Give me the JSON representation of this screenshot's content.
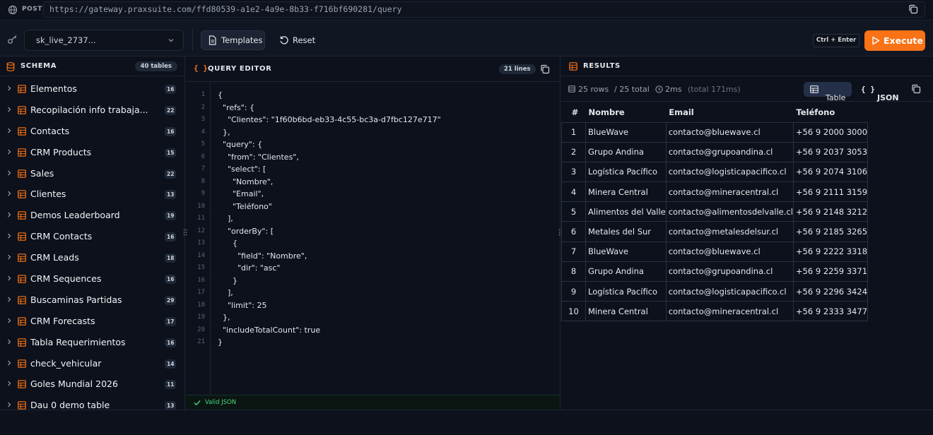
{
  "request": {
    "method": "POST",
    "url": "https://gateway.praxsuite.com/ffd80539-a1e2-4a9e-8b33-f716bf690281/query"
  },
  "toolbar": {
    "api_key": "sk_live_2737...",
    "templates_label": "Templates",
    "reset_label": "Reset",
    "shortcut": "Ctrl + Enter",
    "execute_label": "Execute",
    "accent_color": "#f97316"
  },
  "schema": {
    "title": "SCHEMA",
    "table_count": "40 tables",
    "tables": [
      {
        "name": "Elementos",
        "count": "16"
      },
      {
        "name": "Recopilación info trabaja...",
        "count": "22"
      },
      {
        "name": "Contacts",
        "count": "16"
      },
      {
        "name": "CRM Products",
        "count": "15"
      },
      {
        "name": "Sales",
        "count": "22"
      },
      {
        "name": "Clientes",
        "count": "13"
      },
      {
        "name": "Demos Leaderboard",
        "count": "19"
      },
      {
        "name": "CRM Contacts",
        "count": "16"
      },
      {
        "name": "CRM Leads",
        "count": "18"
      },
      {
        "name": "CRM Sequences",
        "count": "16"
      },
      {
        "name": "Buscaminas Partidas",
        "count": "29"
      },
      {
        "name": "CRM Forecasts",
        "count": "17"
      },
      {
        "name": "Tabla Requerimientos",
        "count": "16"
      },
      {
        "name": "check_vehicular",
        "count": "14"
      },
      {
        "name": "Goles Mundial 2026",
        "count": "11"
      },
      {
        "name": "Dau 0 demo table",
        "count": "13"
      }
    ]
  },
  "editor": {
    "title": "QUERY EDITOR",
    "lines_badge": "21 lines",
    "status": "Valid JSON",
    "lines": [
      "{",
      "  \"refs\": {",
      "    \"Clientes\": \"1f60b6bd-eb33-4c55-bc3a-d7fbc127e717\"",
      "  },",
      "  \"query\": {",
      "    \"from\": \"Clientes\",",
      "    \"select\": [",
      "      \"Nombre\",",
      "      \"Email\",",
      "      \"Teléfono\"",
      "    ],",
      "    \"orderBy\": [",
      "      {",
      "        \"field\": \"Nombre\",",
      "        \"dir\": \"asc\"",
      "      }",
      "    ],",
      "    \"limit\": 25",
      "  },",
      "  \"includeTotalCount\": true",
      "}"
    ]
  },
  "results": {
    "title": "RESULTS",
    "rows_label": "25 rows",
    "total_label": "/ 25 total",
    "time_label": "2ms",
    "total_time_label": "(total 171ms)",
    "table_btn": "Table",
    "json_btn": "JSON",
    "columns": [
      "#",
      "Nombre",
      "Email",
      "Teléfono"
    ],
    "rows": [
      [
        "1",
        "BlueWave",
        "contacto@bluewave.cl",
        "+56 9 2000 3000"
      ],
      [
        "2",
        "Grupo Andina",
        "contacto@grupoandina.cl",
        "+56 9 2037 3053"
      ],
      [
        "3",
        "Logística Pacífico",
        "contacto@logisticapacifico.cl",
        "+56 9 2074 3106"
      ],
      [
        "4",
        "Minera Central",
        "contacto@mineracentral.cl",
        "+56 9 2111 3159"
      ],
      [
        "5",
        "Alimentos del Valle",
        "contacto@alimentosdelvalle.cl",
        "+56 9 2148 3212"
      ],
      [
        "6",
        "Metales del Sur",
        "contacto@metalesdelsur.cl",
        "+56 9 2185 3265"
      ],
      [
        "7",
        "BlueWave",
        "contacto@bluewave.cl",
        "+56 9 2222 3318"
      ],
      [
        "8",
        "Grupo Andina",
        "contacto@grupoandina.cl",
        "+56 9 2259 3371"
      ],
      [
        "9",
        "Logística Pacífico",
        "contacto@logisticapacifico.cl",
        "+56 9 2296 3424"
      ],
      [
        "10",
        "Minera Central",
        "contacto@mineracentral.cl",
        "+56 9 2333 3477"
      ]
    ]
  }
}
